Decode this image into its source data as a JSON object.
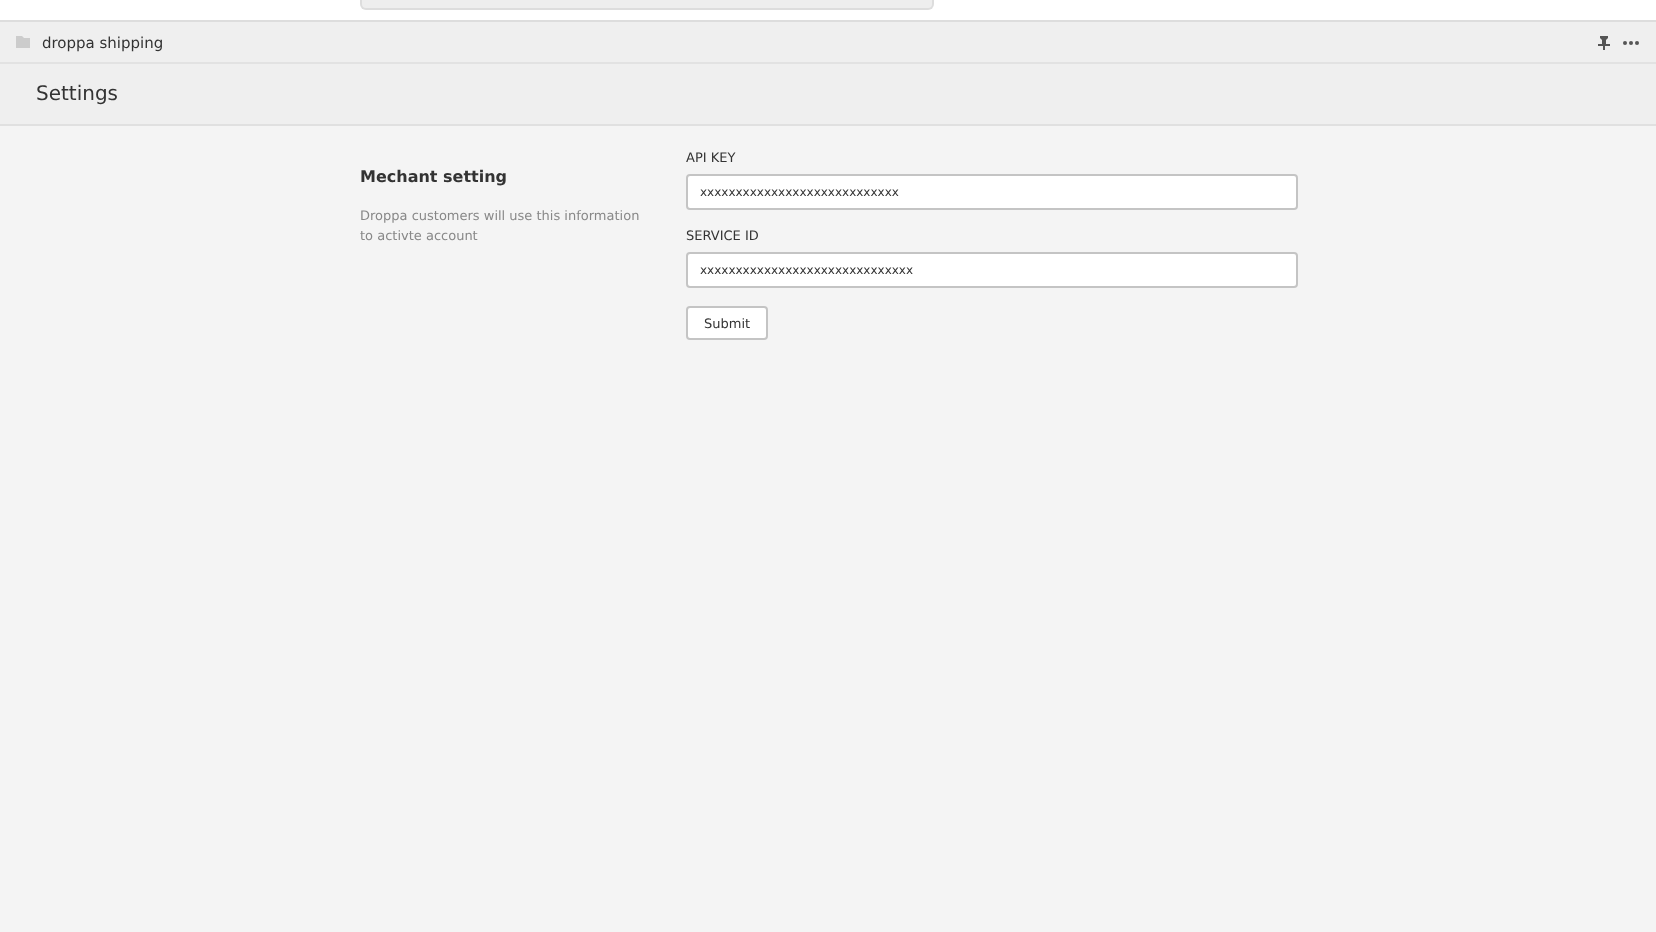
{
  "app_bar": {
    "title": "droppa shipping"
  },
  "page": {
    "title": "Settings"
  },
  "section": {
    "title": "Mechant setting",
    "description": "Droppa customers will use this information to activte account"
  },
  "fields": [
    {
      "label": "API KEY",
      "value": "xxxxxxxxxxxxxxxxxxxxxxxxxxxx"
    },
    {
      "label": "SERVICE ID",
      "value": "xxxxxxxxxxxxxxxxxxxxxxxxxxxxxx"
    }
  ],
  "submit": {
    "label": "Submit"
  }
}
